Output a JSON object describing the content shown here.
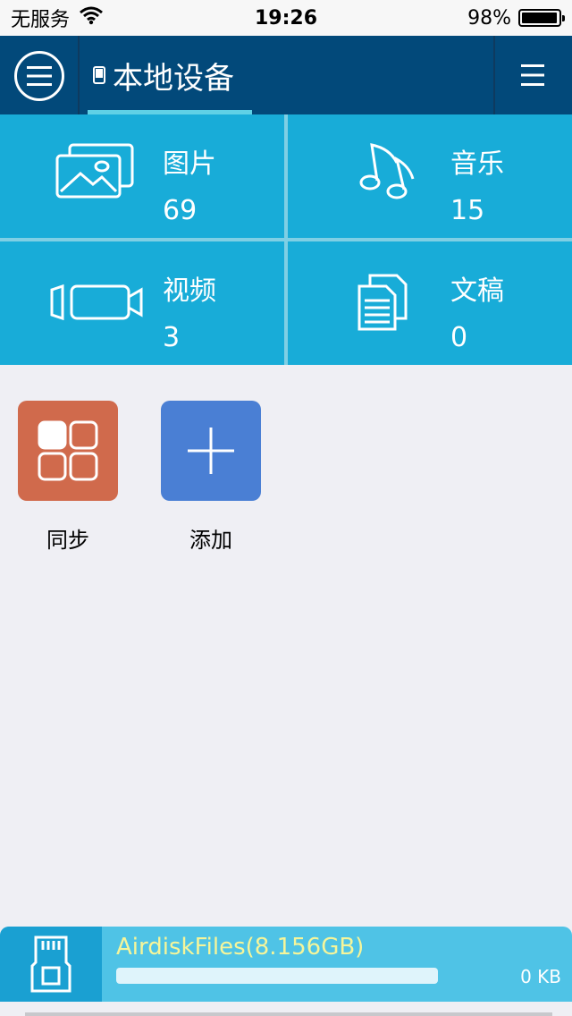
{
  "status_bar": {
    "carrier": "无服务",
    "time": "19:26",
    "battery_percent_label": "98%",
    "battery_level": 0.98
  },
  "nav": {
    "menu_icon": "menu-circle-icon",
    "device_icon": "phone-icon",
    "device_label": "本地设备",
    "list_icon": "list-menu-icon"
  },
  "categories": [
    {
      "title": "图片",
      "count": "69",
      "icon": "picture-icon"
    },
    {
      "title": "音乐",
      "count": "15",
      "icon": "music-icon"
    },
    {
      "title": "视频",
      "count": "3",
      "icon": "video-icon"
    },
    {
      "title": "文稿",
      "count": "0",
      "icon": "document-icon"
    }
  ],
  "actions": [
    {
      "label": "同步",
      "icon": "sync-grid-icon",
      "color": "#d06a4c"
    },
    {
      "label": "添加",
      "icon": "plus-icon",
      "color": "#4a7fd4"
    }
  ],
  "storage": {
    "name": "AirdiskFiles(8.156GB)",
    "used": "0 KB",
    "usage_fraction": 0.0,
    "icon": "sd-card-icon"
  },
  "colors": {
    "nav_bg": "#02497a",
    "tile_bg": "#18acd8",
    "accent_underline": "#5fd1e6",
    "storage_bg": "#4fc3e6",
    "storage_name_text": "#f5f59a"
  }
}
